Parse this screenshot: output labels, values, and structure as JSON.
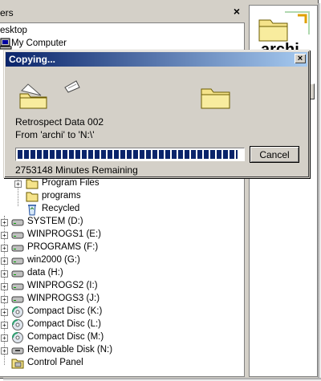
{
  "explorer": {
    "folders_title": "ers",
    "close_glyph": "×",
    "right_pane_label": "archi",
    "tree_top": [
      {
        "label": "esktop",
        "icon": "desktop-icon"
      },
      {
        "label": "My Computer",
        "icon": "computer-icon"
      }
    ],
    "tree_items": [
      {
        "label": "Program Files",
        "icon": "folder-icon",
        "expander": "+"
      },
      {
        "label": "programs",
        "icon": "folder-icon",
        "expander": ""
      },
      {
        "label": "Recycled",
        "icon": "recycle-bin-icon",
        "expander": ""
      },
      {
        "label": "SYSTEM (D:)",
        "icon": "drive-icon",
        "expander": "+"
      },
      {
        "label": "WINPROGS1 (E:)",
        "icon": "drive-icon",
        "expander": "+"
      },
      {
        "label": "PROGRAMS (F:)",
        "icon": "drive-icon",
        "expander": "+"
      },
      {
        "label": "win2000 (G:)",
        "icon": "drive-icon",
        "expander": "+"
      },
      {
        "label": "data (H:)",
        "icon": "drive-icon",
        "expander": "+"
      },
      {
        "label": "WINPROGS2 (I:)",
        "icon": "drive-icon",
        "expander": "+"
      },
      {
        "label": "WINPROGS3 (J:)",
        "icon": "drive-icon",
        "expander": "+"
      },
      {
        "label": "Compact Disc (K:)",
        "icon": "cd-icon",
        "expander": "+"
      },
      {
        "label": "Compact Disc (L:)",
        "icon": "cd-icon",
        "expander": "+"
      },
      {
        "label": "Compact Disc (M:)",
        "icon": "cd-icon",
        "expander": "+"
      },
      {
        "label": "Removable Disk (N:)",
        "icon": "removable-disk-icon",
        "expander": "+"
      },
      {
        "label": "Control Panel",
        "icon": "control-panel-icon",
        "expander": ""
      }
    ]
  },
  "dialog": {
    "title": "Copying...",
    "close_glyph": "×",
    "file_name": "Retrospect Data 002",
    "from_to": "From 'archi' to 'N:\\'",
    "remaining": "2753148 Minutes Remaining",
    "cancel_label": "Cancel",
    "progress_fraction": 0.98
  },
  "colors": {
    "titlebar_start": "#0a246a",
    "titlebar_end": "#a6caf0",
    "progress": "#0a246a",
    "window_face": "#d4d0c8",
    "folder_yellow": "#f5e38a"
  }
}
